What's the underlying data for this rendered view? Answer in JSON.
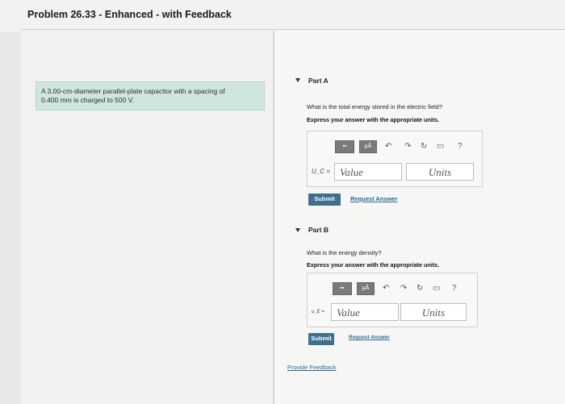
{
  "header": {
    "title": "Problem 26.33 - Enhanced - with Feedback"
  },
  "problem": {
    "line1": "A 3.00-cm-diameter parallel-plate capacitor with a spacing of",
    "line2": "0.400 mm is charged to 500 V."
  },
  "partA": {
    "label": "Part A",
    "question": "What is the total energy stored in the electric field?",
    "instruction": "Express your answer with the appropriate units.",
    "var_label": "U_C =",
    "value_placeholder": "Value",
    "units_placeholder": "Units",
    "submit_label": "Submit",
    "request_label": "Request Answer"
  },
  "partB": {
    "label": "Part B",
    "question": "What is the energy density?",
    "instruction": "Express your answer with the appropriate units.",
    "var_label": "u_E =",
    "value_placeholder": "Value",
    "units_placeholder": "Units",
    "submit_label": "Submit",
    "request_label": "Request Answer"
  },
  "toolbar": {
    "mu_label": "μÅ",
    "help": "?"
  },
  "footer": {
    "feedback_label": "Provide Feedback"
  }
}
